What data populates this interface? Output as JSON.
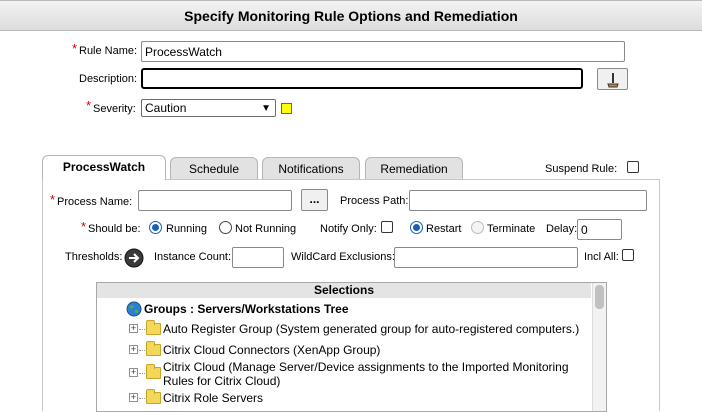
{
  "header": {
    "title": "Specify Monitoring Rule Options and Remediation"
  },
  "form": {
    "rule_name_label": "Rule Name:",
    "rule_name_value": "ProcessWatch",
    "description_label": "Description:",
    "description_value": "",
    "severity_label": "Severity:",
    "severity_value": "Caution",
    "severity_color": "#ffff00",
    "required_mark": "*"
  },
  "tabs": [
    {
      "label": "ProcessWatch",
      "active": true
    },
    {
      "label": "Schedule",
      "active": false
    },
    {
      "label": "Notifications",
      "active": false
    },
    {
      "label": "Remediation",
      "active": false
    }
  ],
  "suspend_rule": {
    "label": "Suspend Rule:",
    "checked": false
  },
  "process": {
    "name_label": "Process Name:",
    "name_value": "",
    "browse_label": "...",
    "path_label": "Process Path:",
    "path_value": ""
  },
  "state": {
    "should_be_label": "Should be:",
    "running_label": "Running",
    "not_running_label": "Not Running",
    "selected": "Running",
    "notify_only_label": "Notify Only:",
    "notify_only_checked": false,
    "restart_label": "Restart",
    "terminate_label": "Terminate",
    "action_selected": "Restart",
    "delay_label": "Delay:",
    "delay_value": "0"
  },
  "thresholds": {
    "label": "Thresholds:",
    "instance_count_label": "Instance Count:",
    "instance_count_value": "",
    "wildcard_label": "WildCard Exclusions:",
    "wildcard_value": "",
    "incl_all_label": "Incl All:",
    "incl_all_checked": false
  },
  "selections": {
    "title": "Selections",
    "root_label": "Groups : Servers/Workstations Tree",
    "items": [
      {
        "label": "Auto Register Group (System generated group for auto-registered computers.)"
      },
      {
        "label": "Citrix Cloud Connectors (XenApp Group)"
      },
      {
        "label_line1": "Citrix Cloud (Manage Server/Device assignments to the Imported Monitoring",
        "label_line2": "Rules for Citrix Cloud)"
      },
      {
        "label": "Citrix Role Servers"
      }
    ]
  }
}
